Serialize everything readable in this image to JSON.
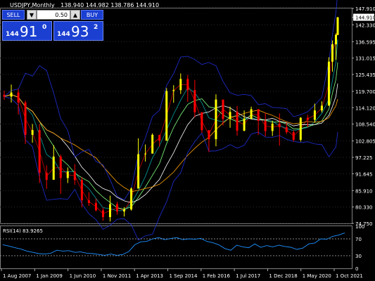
{
  "header": {
    "symbol": "USDJPY,Monthly",
    "ohlc": "138.940 144.982 138.786 144.910"
  },
  "trade_panel": {
    "sell_label": "SELL",
    "buy_label": "BUY",
    "lot": "0.50",
    "down_symbol": "▼",
    "up_symbol": "▲",
    "bid_small": "144",
    "bid_big": "91",
    "bid_sup": "0",
    "ask_small": "144",
    "ask_big": "93",
    "ask_sup": "2",
    "button_color": "#1a3fd1"
  },
  "colors": {
    "background": "#000000",
    "grid": "#2a2a2a",
    "bull_candle": "#ffff00",
    "bear_candle": "#ff0000",
    "bollinger": "#1f2fd8",
    "rsi_line": "#1e90ff",
    "current_price_box": "#ffffff",
    "ma_colors": [
      "#c80000",
      "#00a0a0",
      "#80ff80",
      "#ffffff",
      "#ffa000"
    ]
  },
  "chart_data": [
    {
      "type": "candlestick",
      "title": "USDJPY,Monthly",
      "current_price": 144.91,
      "price_axis_labels": [
        "147.910",
        "144.910",
        "142.330",
        "136.595",
        "131.015",
        "125.435",
        "119.700",
        "114.120",
        "108.540",
        "102.805",
        "97.225",
        "91.645",
        "85.910",
        "80.330",
        "74.750"
      ],
      "ylim": [
        74.75,
        147.91
      ],
      "date_axis_labels": [
        "1 Aug 2007",
        "1 Jan 2009",
        "1 Jun 2010",
        "1 Nov 2011",
        "1 Apr 2013",
        "1 Sep 2014",
        "1 Feb 2016",
        "1 Jul 2017",
        "1 Dec 2018",
        "1 May 2020",
        "1 Oct 2021"
      ],
      "x_start": "2006-12",
      "x_end": "2022-09",
      "bars": [
        [
          "2006-12",
          118.5,
          119.9,
          116.8,
          117.9
        ],
        [
          "2007-04",
          117.9,
          122.0,
          115.9,
          119.3
        ],
        [
          "2007-08",
          119.3,
          120.5,
          111.8,
          115.9
        ],
        [
          "2007-12",
          115.9,
          116.6,
          101.8,
          104.9
        ],
        [
          "2008-04",
          104.9,
          108.6,
          102.2,
          106.5
        ],
        [
          "2008-08",
          106.5,
          108.6,
          88.5,
          92.0
        ],
        [
          "2008-12",
          92.0,
          94.5,
          86.5,
          89.6
        ],
        [
          "2009-04",
          89.6,
          101.4,
          93.0,
          97.5
        ],
        [
          "2009-08",
          97.5,
          98.2,
          84.8,
          90.2
        ],
        [
          "2009-12",
          90.2,
          93.8,
          88.5,
          92.4
        ],
        [
          "2010-04",
          92.4,
          94.9,
          87.9,
          89.5
        ],
        [
          "2010-08",
          89.5,
          90.5,
          80.2,
          82.6
        ],
        [
          "2010-12",
          82.6,
          85.4,
          80.7,
          81.7
        ],
        [
          "2011-04",
          81.7,
          83.2,
          78.8,
          79.2
        ],
        [
          "2011-08",
          79.2,
          80.1,
          75.6,
          76.9
        ],
        [
          "2011-12",
          76.9,
          84.2,
          75.4,
          81.3
        ],
        [
          "2012-04",
          81.3,
          82.1,
          77.7,
          78.8
        ],
        [
          "2012-08",
          78.8,
          80.3,
          77.1,
          79.5
        ],
        [
          "2012-12",
          79.5,
          87.0,
          79.1,
          86.6
        ],
        [
          "2013-04",
          86.6,
          103.7,
          92.5,
          98.3
        ],
        [
          "2013-08",
          98.3,
          101.6,
          95.8,
          98.5
        ],
        [
          "2013-12",
          98.5,
          105.4,
          100.7,
          104.9
        ],
        [
          "2014-04",
          104.9,
          104.2,
          100.8,
          102.9
        ],
        [
          "2014-08",
          102.9,
          120.8,
          104.2,
          119.8
        ],
        [
          "2014-12",
          119.8,
          121.8,
          115.8,
          120.1
        ],
        [
          "2015-04",
          120.1,
          125.8,
          118.8,
          123.9
        ],
        [
          "2015-08",
          123.9,
          125.3,
          116.1,
          120.1
        ],
        [
          "2015-12",
          120.1,
          123.6,
          110.9,
          112.6
        ],
        [
          "2016-04",
          112.6,
          111.9,
          105.6,
          106.5
        ],
        [
          "2016-08",
          106.5,
          104.3,
          99.0,
          103.4
        ],
        [
          "2016-12",
          103.4,
          118.7,
          101.0,
          116.9
        ],
        [
          "2017-04",
          116.9,
          114.5,
          108.1,
          110.3
        ],
        [
          "2017-08",
          110.3,
          114.5,
          107.3,
          112.7
        ],
        [
          "2017-12",
          112.7,
          114.7,
          104.6,
          106.3
        ],
        [
          "2018-04",
          106.3,
          113.2,
          106.1,
          110.4
        ],
        [
          "2018-08",
          110.4,
          114.5,
          110.2,
          113.6
        ],
        [
          "2018-12",
          113.6,
          113.7,
          104.9,
          109.7
        ],
        [
          "2019-04",
          109.7,
          112.4,
          104.4,
          106.2
        ],
        [
          "2019-08",
          106.2,
          109.7,
          104.5,
          108.7
        ],
        [
          "2019-12",
          108.7,
          112.2,
          101.2,
          107.5
        ],
        [
          "2020-04",
          107.5,
          109.0,
          105.2,
          105.8
        ],
        [
          "2020-08",
          105.8,
          106.5,
          102.6,
          103.2
        ],
        [
          "2020-12",
          103.2,
          110.9,
          102.6,
          110.7
        ],
        [
          "2021-04",
          110.7,
          111.7,
          107.5,
          110.0
        ],
        [
          "2021-08",
          110.0,
          115.5,
          109.1,
          113.2
        ],
        [
          "2021-12",
          113.2,
          116.3,
          112.5,
          114.8
        ],
        [
          "2022-04",
          114.8,
          131.3,
          121.3,
          129.8
        ],
        [
          "2022-06",
          129.8,
          137.0,
          126.4,
          135.7
        ],
        [
          "2022-08",
          135.7,
          139.4,
          130.4,
          138.9
        ],
        [
          "2022-09",
          138.9,
          144.98,
          138.79,
          144.91
        ]
      ]
    },
    {
      "type": "line",
      "title": "RSI(14) 83.9265",
      "indicator_label": "RSI(14) 83.9265",
      "axis_labels": [
        "100",
        "70",
        "30",
        "0"
      ],
      "ylim": [
        0,
        100
      ],
      "levels": [
        70,
        30
      ],
      "values": [
        56,
        53,
        49,
        46,
        41,
        38,
        35,
        34,
        36,
        43,
        41,
        42,
        38,
        39,
        36,
        35,
        33,
        31,
        34,
        31,
        33,
        40,
        56,
        63,
        64,
        70,
        73,
        68,
        71,
        73,
        68,
        70,
        69,
        71,
        64,
        61,
        56,
        47,
        43,
        55,
        51,
        49,
        58,
        50,
        54,
        51,
        55,
        52,
        50,
        45,
        48,
        58,
        60,
        70,
        69,
        76,
        79,
        84
      ]
    }
  ]
}
